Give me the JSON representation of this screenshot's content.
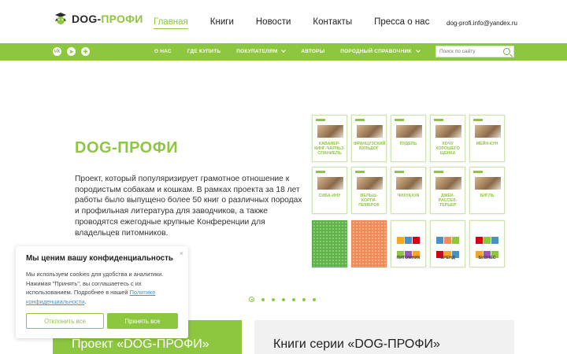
{
  "header": {
    "logo": {
      "prefix": "DOG-",
      "suffix": "ПРОФИ"
    },
    "nav": [
      "Главная",
      "Книги",
      "Новости",
      "Контакты",
      "Пресса о нас"
    ],
    "active_nav": "Главная",
    "email": "dog-profi.info@yandex.ru"
  },
  "subbar": {
    "social": [
      "vk-icon",
      "telegram-icon",
      "ok-icon"
    ],
    "items": [
      {
        "label": "О НАС",
        "dropdown": false
      },
      {
        "label": "ГДЕ КУПИТЬ",
        "dropdown": false
      },
      {
        "label": "ПОКУПАТЕЛЯМ",
        "dropdown": true
      },
      {
        "label": "АВТОРЫ",
        "dropdown": false
      },
      {
        "label": "ПОРОДНЫЙ СПРАВОЧНИК",
        "dropdown": true
      }
    ],
    "search_placeholder": "Поиск по сайту"
  },
  "hero": {
    "title": "DOG-ПРОФИ",
    "text": "Проект, который популяризирует грамотное отношение к породистым собакам и кошкам. В рамках проекта за 18 лет работы было выпущено более 50 книг о различных породах и профильная литература для заводчиков, а также проводятся ежегодные крупные Конференции для владельцев питомников."
  },
  "books": [
    {
      "title": "КАВАЛЕР-КИНГ-ЧАРЛЬЗ-СПАНИЕЛЬ",
      "style": "breed"
    },
    {
      "title": "ФРАНЦУЗСКИЙ БУЛЬДОГ",
      "style": "breed"
    },
    {
      "title": "ПУДЕЛЬ",
      "style": "breed"
    },
    {
      "title": "ХОЧУ ХОРОШЕГО ЩЕНКА",
      "style": "breed"
    },
    {
      "title": "МЕЙН-КУН",
      "style": "breed"
    },
    {
      "title": "СИБА-ИНУ",
      "style": "breed"
    },
    {
      "title": "ВЕЛЬШ-КОРГИ-ПЕМБРОК",
      "style": "breed"
    },
    {
      "title": "ЧИХУАХУА",
      "style": "breed"
    },
    {
      "title": "ДЖЕК-РАССЕЛ-ТЕРЬЕР",
      "style": "breed"
    },
    {
      "title": "БИГЛЬ",
      "style": "breed"
    },
    {
      "title": "",
      "style": "green"
    },
    {
      "title": "",
      "style": "orange"
    },
    {
      "title": "ПИТОМНИК",
      "style": "biz"
    },
    {
      "title": "БРЕНД",
      "style": "biz"
    },
    {
      "title": "БИЗНЕС",
      "style": "biz"
    }
  ],
  "slider": {
    "count": 7,
    "active": 0
  },
  "cards": {
    "left": "Проект «DOG-ПРОФИ»",
    "right": "Книги серии «DOG-ПРОФИ»"
  },
  "cookie": {
    "title": "Мы ценим вашу конфиденциальность",
    "text": "Мы используем cookies для удобства и аналитики. Нажимая \"Принять\", вы соглашаетесь с их использованием. Подробнее в нашей ",
    "link": "Политике конфиденциальности",
    "tail": ".",
    "decline": "Отклонить все",
    "accept": "Принять все",
    "close": "×"
  },
  "colors": {
    "accent": "#8dc63f",
    "link": "#4a90c2"
  }
}
